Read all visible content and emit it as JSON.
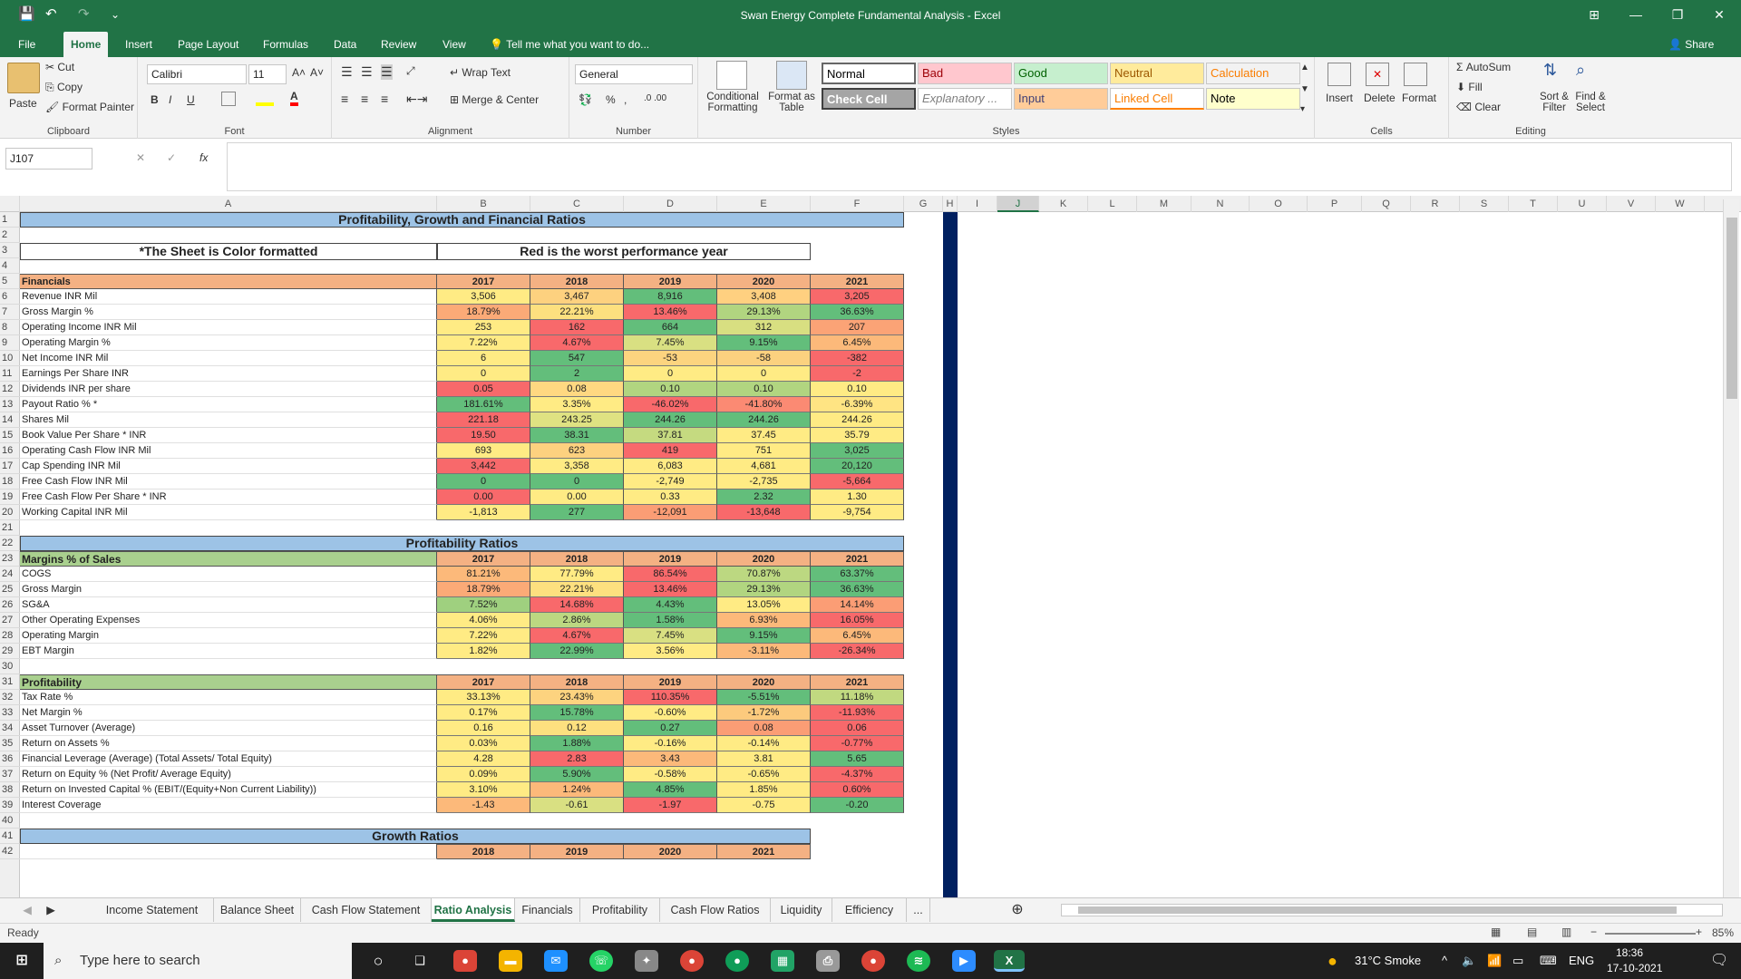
{
  "window": {
    "title": "Swan Energy Complete Fundamental Analysis - Excel",
    "minimize": "—",
    "restore": "❐",
    "close": "✕",
    "ribbon_display": "⊞"
  },
  "quick_access": {
    "save": "💾",
    "undo": "↶",
    "redo": "↷",
    "customize": "⌄"
  },
  "tabs": [
    "File",
    "Home",
    "Insert",
    "Page Layout",
    "Formulas",
    "Data",
    "Review",
    "View"
  ],
  "active_tab": "Home",
  "tell_me": "Tell me what you want to do...",
  "share": "Share",
  "ribbon": {
    "clipboard": {
      "paste": "Paste",
      "cut": "Cut",
      "copy": "Copy",
      "painter": "Format Painter",
      "label": "Clipboard"
    },
    "font": {
      "name": "Calibri",
      "size": "11",
      "bold": "B",
      "italic": "I",
      "underline": "U",
      "grow": "A˄",
      "shrink": "A˅",
      "label": "Font"
    },
    "alignment": {
      "wrap": "Wrap Text",
      "merge": "Merge & Center",
      "label": "Alignment"
    },
    "number": {
      "format": "General",
      "percent": "%",
      "comma": ",",
      "inc_dec": ".0 .00",
      "label": "Number"
    },
    "cond": {
      "conditional": "Conditional Formatting",
      "format_table": "Format as Table"
    },
    "styles": {
      "label": "Styles",
      "items": [
        {
          "name": "Normal",
          "bg": "#ffffff",
          "fg": "#000000"
        },
        {
          "name": "Bad",
          "bg": "#ffc7ce",
          "fg": "#9c0006"
        },
        {
          "name": "Good",
          "bg": "#c6efce",
          "fg": "#006100"
        },
        {
          "name": "Neutral",
          "bg": "#ffeb9c",
          "fg": "#9c5700"
        },
        {
          "name": "Calculation",
          "bg": "#f2f2f2",
          "fg": "#fa7d00"
        },
        {
          "name": "Check Cell",
          "bg": "#a5a5a5",
          "fg": "#ffffff"
        },
        {
          "name": "Explanatory ...",
          "bg": "#ffffff",
          "fg": "#7f7f7f"
        },
        {
          "name": "Input",
          "bg": "#ffcc99",
          "fg": "#3f3f76"
        },
        {
          "name": "Linked Cell",
          "bg": "#ffffff",
          "fg": "#fa7d00"
        },
        {
          "name": "Note",
          "bg": "#ffffcc",
          "fg": "#000000"
        }
      ]
    },
    "cells": {
      "insert": "Insert",
      "delete": "Delete",
      "format": "Format",
      "label": "Cells"
    },
    "editing": {
      "autosum": "AutoSum",
      "fill": "Fill",
      "clear": "Clear",
      "sort": "Sort & Filter",
      "find": "Find & Select",
      "label": "Editing"
    }
  },
  "formula_bar": {
    "name_box": "J107",
    "cancel": "✕",
    "enter": "✓",
    "fx": "fx",
    "value": ""
  },
  "columns": [
    "A",
    "B",
    "C",
    "D",
    "E",
    "F",
    "G",
    "H",
    "I",
    "J",
    "K",
    "L",
    "M",
    "N",
    "O",
    "P",
    "Q",
    "R",
    "S",
    "T",
    "U",
    "V",
    "W"
  ],
  "sheet": {
    "title": "Profitability, Growth and Financial Ratios",
    "note_left": "*The Sheet is Color formatted",
    "note_right": "Red is the worst performance year",
    "years5": [
      "2017",
      "2018",
      "2019",
      "2020",
      "2021"
    ],
    "years4": [
      "2018",
      "2019",
      "2020",
      "2021"
    ],
    "financials_label": "Financials",
    "financials": [
      {
        "label": "Revenue INR Mil",
        "values": [
          "3,506",
          "3,467",
          "8,916",
          "3,408",
          "3,205"
        ],
        "colors": [
          "#ffeb84",
          "#fdd17f",
          "#63be7b",
          "#ffd080",
          "#f8696b"
        ]
      },
      {
        "label": "Gross Margin %",
        "values": [
          "18.79%",
          "22.21%",
          "13.46%",
          "29.13%",
          "36.63%"
        ],
        "colors": [
          "#fbaa77",
          "#fde07f",
          "#f8696b",
          "#b1d580",
          "#63be7b"
        ]
      },
      {
        "label": "Operating Income INR Mil",
        "values": [
          "253",
          "162",
          "664",
          "312",
          "207"
        ],
        "colors": [
          "#ffeb84",
          "#f8696b",
          "#63be7b",
          "#d8df81",
          "#fba376"
        ]
      },
      {
        "label": "Operating Margin %",
        "values": [
          "7.22%",
          "4.67%",
          "7.45%",
          "9.15%",
          "6.45%"
        ],
        "colors": [
          "#ffeb84",
          "#f8696b",
          "#d9e082",
          "#63be7b",
          "#fcb97a"
        ]
      },
      {
        "label": "Net Income INR Mil",
        "values": [
          "6",
          "547",
          "-53",
          "-58",
          "-382"
        ],
        "colors": [
          "#ffeb84",
          "#63be7b",
          "#fcd47f",
          "#fbd17f",
          "#f8696b"
        ]
      },
      {
        "label": "Earnings Per Share INR",
        "values": [
          "0",
          "2",
          "0",
          "0",
          "-2"
        ],
        "colors": [
          "#ffeb84",
          "#63be7b",
          "#ffeb84",
          "#ffeb84",
          "#f8696b"
        ]
      },
      {
        "label": "Dividends INR per share",
        "values": [
          "0.05",
          "0.08",
          "0.10",
          "0.10",
          "0.10"
        ],
        "colors": [
          "#f8696b",
          "#ffd881",
          "#b1d580",
          "#b1d580",
          "#ffeb84"
        ]
      },
      {
        "label": "Payout Ratio % *",
        "values": [
          "181.61%",
          "3.35%",
          "-46.02%",
          "-41.80%",
          "-6.39%"
        ],
        "colors": [
          "#63be7b",
          "#ffeb84",
          "#f8696b",
          "#fb8a73",
          "#ffe483"
        ]
      },
      {
        "label": "Shares Mil",
        "values": [
          "221.18",
          "243.25",
          "244.26",
          "244.26",
          "244.26"
        ],
        "colors": [
          "#f8696b",
          "#dfe282",
          "#63be7b",
          "#63be7b",
          "#ffeb84"
        ]
      },
      {
        "label": "Book Value Per Share * INR",
        "values": [
          "19.50",
          "38.31",
          "37.81",
          "37.45",
          "35.79"
        ],
        "colors": [
          "#f8696b",
          "#63be7b",
          "#c5da80",
          "#ffeb84",
          "#ffeb84"
        ]
      },
      {
        "label": "Operating Cash Flow INR Mil",
        "values": [
          "693",
          "623",
          "419",
          "751",
          "3,025"
        ],
        "colors": [
          "#ffeb84",
          "#fdd17f",
          "#f8696b",
          "#ffeb84",
          "#63be7b"
        ]
      },
      {
        "label": "Cap Spending INR Mil",
        "values": [
          "3,442",
          "3,358",
          "6,083",
          "4,681",
          "20,120"
        ],
        "colors": [
          "#f8696b",
          "#ffeb84",
          "#ffeb84",
          "#ffeb84",
          "#63be7b"
        ]
      },
      {
        "label": "Free Cash Flow INR Mil",
        "values": [
          "0",
          "0",
          "-2,749",
          "-2,735",
          "-5,664"
        ],
        "colors": [
          "#63be7b",
          "#63be7b",
          "#ffeb84",
          "#ffeb84",
          "#f8696b"
        ]
      },
      {
        "label": "Free Cash Flow Per Share * INR",
        "values": [
          "0.00",
          "0.00",
          "0.33",
          "2.32",
          "1.30"
        ],
        "colors": [
          "#f8696b",
          "#ffeb84",
          "#ffeb84",
          "#63be7b",
          "#ffeb84"
        ]
      },
      {
        "label": "Working Capital INR Mil",
        "values": [
          "-1,813",
          "277",
          "-12,091",
          "-13,648",
          "-9,754"
        ],
        "colors": [
          "#ffeb84",
          "#63be7b",
          "#fb9d75",
          "#f8696b",
          "#ffeb84"
        ]
      }
    ],
    "profitability_title": "Profitability Ratios",
    "margins_label": "Margins % of Sales",
    "margins": [
      {
        "label": "COGS",
        "values": [
          "81.21%",
          "77.79%",
          "86.54%",
          "70.87%",
          "63.37%"
        ],
        "colors": [
          "#fcb97a",
          "#ffeb84",
          "#f8696b",
          "#bcd881",
          "#63be7b"
        ]
      },
      {
        "label": "Gross Margin",
        "values": [
          "18.79%",
          "22.21%",
          "13.46%",
          "29.13%",
          "36.63%"
        ],
        "colors": [
          "#fbaa77",
          "#fde07f",
          "#f8696b",
          "#b1d580",
          "#63be7b"
        ]
      },
      {
        "label": "SG&A",
        "values": [
          "7.52%",
          "14.68%",
          "4.43%",
          "13.05%",
          "14.14%"
        ],
        "colors": [
          "#9fd07f",
          "#f8696b",
          "#63be7b",
          "#ffeb84",
          "#fb9d75"
        ]
      },
      {
        "label": "Other Operating Expenses",
        "values": [
          "4.06%",
          "2.86%",
          "1.58%",
          "6.93%",
          "16.05%"
        ],
        "colors": [
          "#ffeb84",
          "#bcd881",
          "#63be7b",
          "#fcb97a",
          "#f8696b"
        ]
      },
      {
        "label": "Operating Margin",
        "values": [
          "7.22%",
          "4.67%",
          "7.45%",
          "9.15%",
          "6.45%"
        ],
        "colors": [
          "#ffeb84",
          "#f8696b",
          "#d9e082",
          "#63be7b",
          "#fcb97a"
        ]
      },
      {
        "label": "EBT Margin",
        "values": [
          "1.82%",
          "22.99%",
          "3.56%",
          "-3.11%",
          "-26.34%"
        ],
        "colors": [
          "#ffeb84",
          "#63be7b",
          "#ffeb84",
          "#fcb97a",
          "#f8696b"
        ]
      }
    ],
    "prof_label": "Profitability",
    "profitability": [
      {
        "label": "Tax Rate %",
        "values": [
          "33.13%",
          "23.43%",
          "110.35%",
          "-5.51%",
          "11.18%"
        ],
        "colors": [
          "#ffeb84",
          "#fdd37f",
          "#f8696b",
          "#63be7b",
          "#c1d980"
        ]
      },
      {
        "label": "Net Margin %",
        "values": [
          "0.17%",
          "15.78%",
          "-0.60%",
          "-1.72%",
          "-11.93%"
        ],
        "colors": [
          "#ffeb84",
          "#63be7b",
          "#ffeb84",
          "#fcca7d",
          "#f8696b"
        ]
      },
      {
        "label": "Asset Turnover (Average)",
        "values": [
          "0.16",
          "0.12",
          "0.27",
          "0.08",
          "0.06"
        ],
        "colors": [
          "#ffeb84",
          "#fde07f",
          "#63be7b",
          "#fb9d75",
          "#f8696b"
        ]
      },
      {
        "label": "Return on Assets %",
        "values": [
          "0.03%",
          "1.88%",
          "-0.16%",
          "-0.14%",
          "-0.77%"
        ],
        "colors": [
          "#ffeb84",
          "#63be7b",
          "#ffeb84",
          "#ffeb84",
          "#f8696b"
        ]
      },
      {
        "label": "Financial Leverage (Average) (Total Assets/ Total Equity)",
        "values": [
          "4.28",
          "2.83",
          "3.43",
          "3.81",
          "5.65"
        ],
        "colors": [
          "#ffeb84",
          "#f8696b",
          "#fcb97a",
          "#ffeb84",
          "#63be7b"
        ]
      },
      {
        "label": "Return on Equity %  (Net Profit/ Average Equity)",
        "values": [
          "0.09%",
          "5.90%",
          "-0.58%",
          "-0.65%",
          "-4.37%"
        ],
        "colors": [
          "#ffeb84",
          "#63be7b",
          "#ffeb84",
          "#ffeb84",
          "#f8696b"
        ]
      },
      {
        "label": "Return on Invested Capital % (EBIT/(Equity+Non Current Liability))",
        "values": [
          "3.10%",
          "1.24%",
          "4.85%",
          "1.85%",
          "0.60%"
        ],
        "colors": [
          "#ffeb84",
          "#fcb97a",
          "#63be7b",
          "#ffeb84",
          "#f8696b"
        ]
      },
      {
        "label": "Interest Coverage",
        "values": [
          "-1.43",
          "-0.61",
          "-1.97",
          "-0.75",
          "-0.20"
        ],
        "colors": [
          "#fcb97a",
          "#d9e082",
          "#f8696b",
          "#ffeb84",
          "#63be7b"
        ]
      }
    ],
    "growth_title": "Growth Ratios"
  },
  "sheet_tabs": [
    "Income Statement",
    "Balance Sheet",
    "Cash Flow Statement",
    "Ratio Analysis",
    "Financials",
    "Profitability",
    "Cash Flow Ratios",
    "Liquidity",
    "Efficiency",
    "..."
  ],
  "active_sheet": "Ratio Analysis",
  "status": {
    "ready": "Ready",
    "zoom": "85%"
  },
  "taskbar": {
    "search": "Type here to search",
    "weather": "31°C  Smoke",
    "lang": "ENG",
    "time": "18:36",
    "date": "17-10-2021"
  }
}
